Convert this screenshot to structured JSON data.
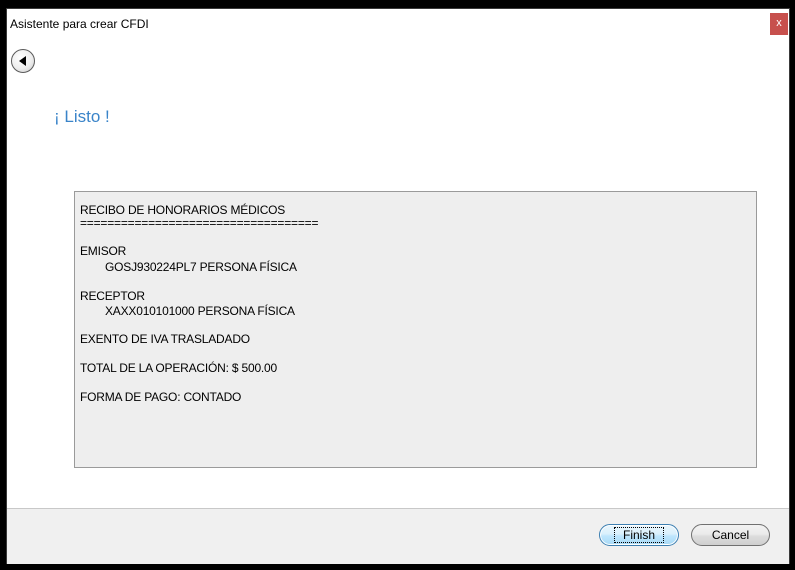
{
  "window": {
    "title": "Asistente para crear CFDI",
    "close_label": "x"
  },
  "page": {
    "heading": "¡ Listo !"
  },
  "summary": {
    "title": "RECIBO DE HONORARIOS MÉDICOS",
    "separator": "===================================",
    "emisor_label": "EMISOR",
    "emisor_value": "GOSJ930224PL7 PERSONA FÍSICA",
    "receptor_label": "RECEPTOR",
    "receptor_value": "XAXX010101000 PERSONA FÍSICA",
    "iva": "EXENTO DE IVA TRASLADADO",
    "total": "TOTAL DE LA OPERACIÓN: $ 500.00",
    "forma_pago": "FORMA DE PAGO: CONTADO"
  },
  "footer": {
    "finish_label": "Finish",
    "cancel_label": "Cancel"
  },
  "icons": {
    "back": "back-arrow-icon"
  },
  "colors": {
    "heading": "#3a84c9",
    "close": "#c7504d",
    "box_background": "#eeeeee",
    "footer_background": "#f0f0f0"
  }
}
